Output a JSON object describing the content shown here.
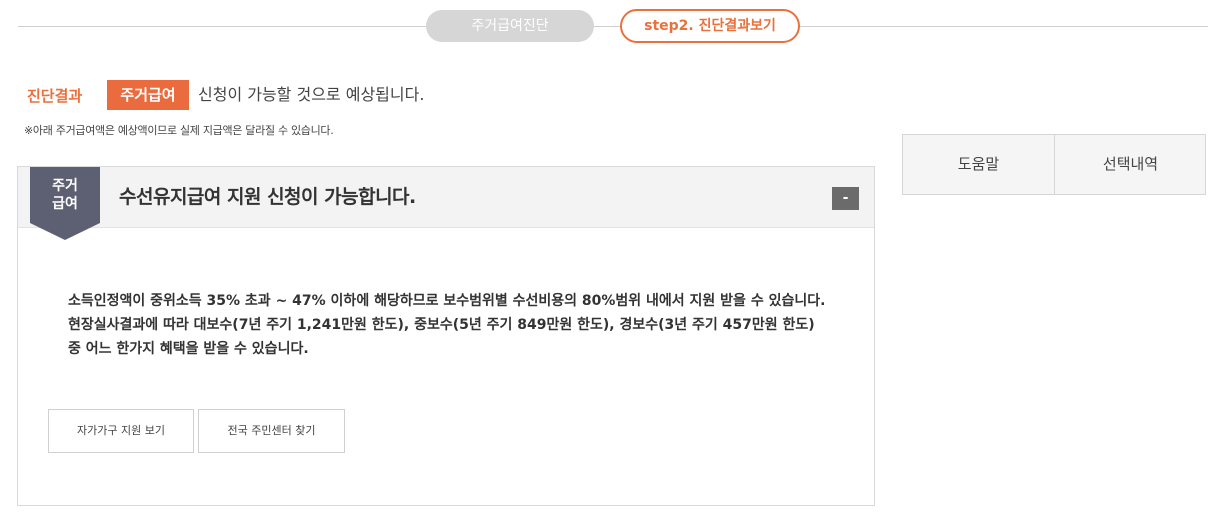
{
  "steps": {
    "step1_label": "주거급여진단",
    "step2_label": "step2. 진단결과보기"
  },
  "result": {
    "label": "진단결과",
    "tag": "주거급여",
    "text": "신청이 가능할 것으로 예상됩니다.",
    "note": "※아래 주거급여액은 예상액이므로 실제 지급액은 달라질 수 있습니다."
  },
  "panel": {
    "ribbon_line1": "주거",
    "ribbon_line2": "급여",
    "title": "수선유지급여 지원 신청이 가능합니다.",
    "collapse_label": "-",
    "desc_line1": "소득인정액이 중위소득 35% 초과 ~ 47% 이하에 해당하므로 보수범위별 수선비용의 80%범위 내에서 지원 받을 수 있습니다.",
    "desc_line2": "현장실사결과에 따라 대보수(7년 주기 1,241만원 한도), 중보수(5년 주기 849만원 한도), 경보수(3년 주기 457만원 한도) 중 어느 한가지 혜택을 받을 수 있습니다.",
    "btn_self_support": "자가가구 지원 보기",
    "btn_find_center": "전국 주민센터 찾기"
  },
  "side_tabs": {
    "help": "도움말",
    "selected": "선택내역"
  },
  "colors": {
    "accent": "#ea6b3d",
    "ribbon": "#5c6072"
  }
}
